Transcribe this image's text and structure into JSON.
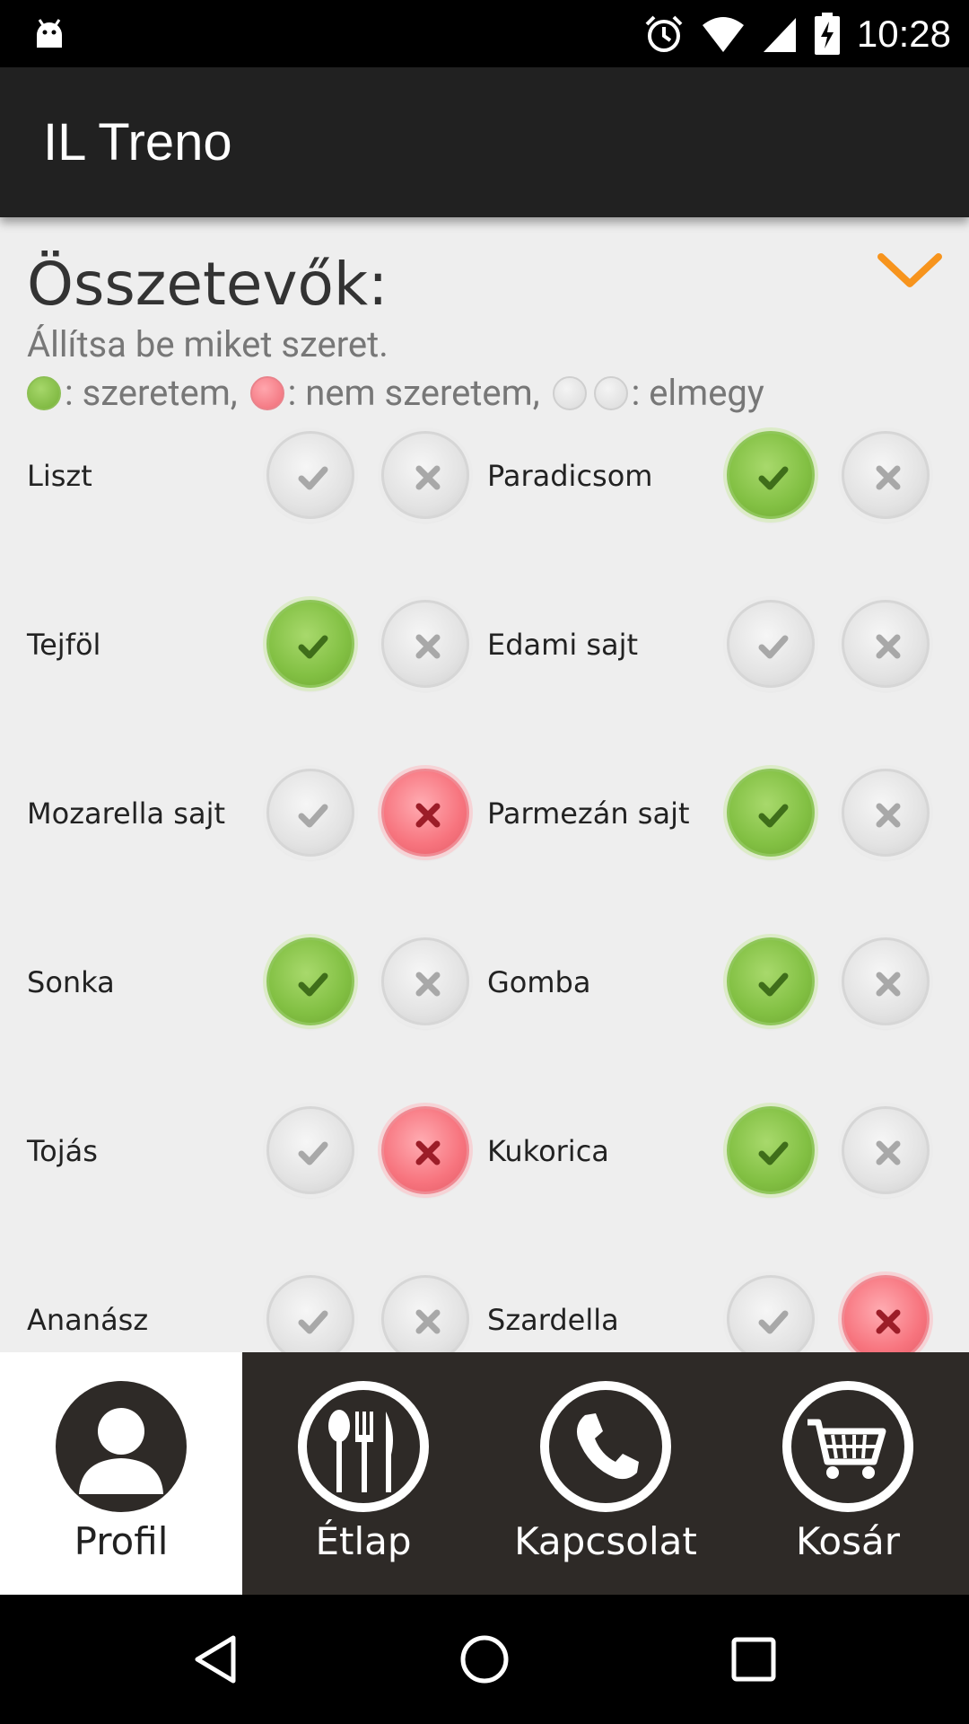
{
  "status_bar": {
    "time": "10:28"
  },
  "app": {
    "title": "IL Treno"
  },
  "section": {
    "title": "Összetevők:",
    "subtitle": "Állítsa be miket szeret.",
    "legend": {
      "like": ": szeretem,",
      "dislike": ": nem szeretem,",
      "neutral": ": elmegy"
    }
  },
  "ingredients": [
    {
      "name": "Liszt",
      "state": "neutral"
    },
    {
      "name": "Paradicsom",
      "state": "like"
    },
    {
      "name": "Tejföl",
      "state": "like"
    },
    {
      "name": "Edami sajt",
      "state": "neutral"
    },
    {
      "name": "Mozarella sajt",
      "state": "dislike"
    },
    {
      "name": "Parmezán sajt",
      "state": "like"
    },
    {
      "name": "Sonka",
      "state": "like"
    },
    {
      "name": "Gomba",
      "state": "like"
    },
    {
      "name": "Tojás",
      "state": "dislike"
    },
    {
      "name": "Kukorica",
      "state": "like"
    },
    {
      "name": "Ananász",
      "state": "neutral"
    },
    {
      "name": "Szardella",
      "state": "dislike"
    }
  ],
  "bottom_nav": [
    {
      "label": "Profil",
      "icon": "person-icon",
      "active": true
    },
    {
      "label": "Étlap",
      "icon": "cutlery-icon",
      "active": false
    },
    {
      "label": "Kapcsolat",
      "icon": "phone-icon",
      "active": false
    },
    {
      "label": "Kosár",
      "icon": "cart-icon",
      "active": false
    }
  ],
  "colors": {
    "accent": "#f7941d",
    "like": "#82c043",
    "dislike": "#f7747e",
    "appbar": "#212121",
    "bottom_nav": "#2e2a27"
  }
}
